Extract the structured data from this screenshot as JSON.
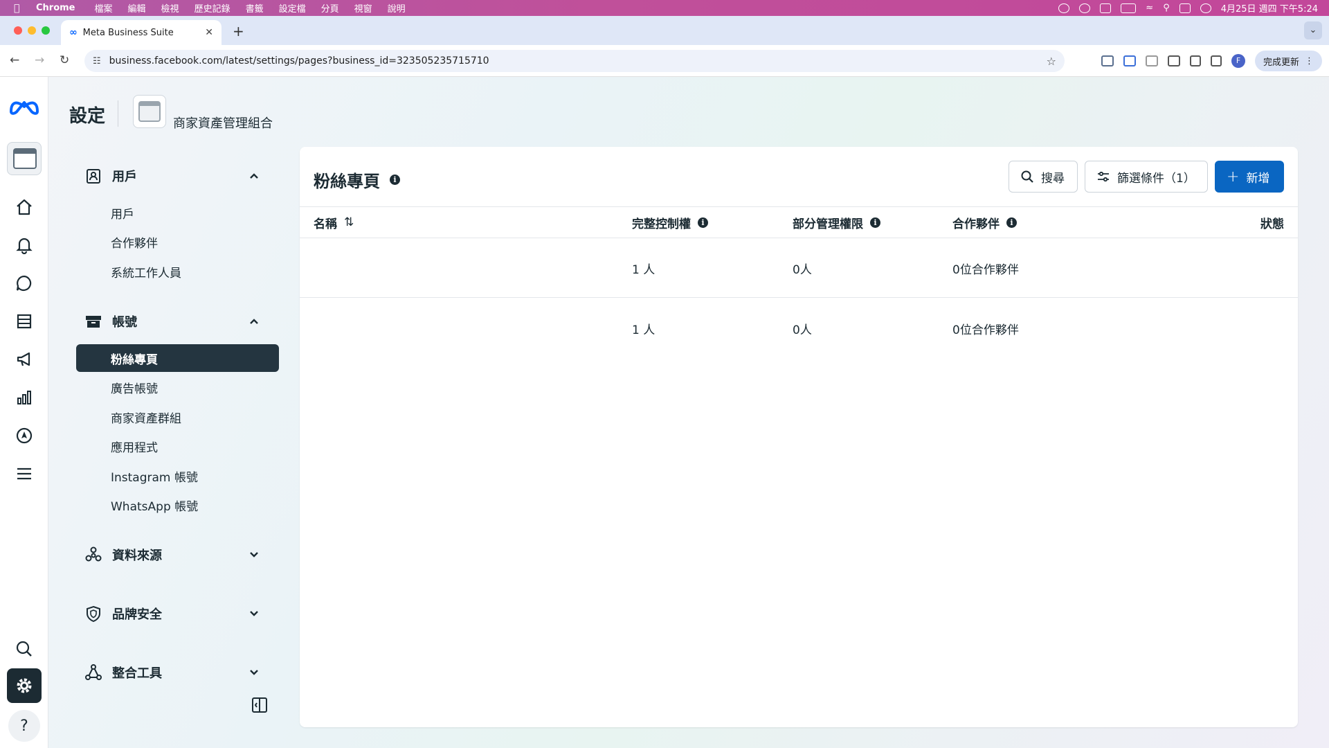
{
  "menubar": {
    "app": "Chrome",
    "menus": [
      "檔案",
      "編輯",
      "檢視",
      "歷史記錄",
      "書籤",
      "設定檔",
      "分頁",
      "視窗",
      "說明"
    ],
    "datetime": "4月25日 週四 下午5:24"
  },
  "browser": {
    "tab_title": "Meta Business Suite",
    "url": "business.facebook.com/latest/settings/pages?business_id=323505235715710",
    "update_label": "完成更新",
    "profile_initial": "F"
  },
  "header": {
    "title": "設定",
    "business_name": "商家資產管理組合"
  },
  "nav": {
    "users_section": "用戶",
    "users_items": [
      "用戶",
      "合作夥伴",
      "系統工作人員"
    ],
    "accounts_section": "帳號",
    "accounts_items": [
      "粉絲專頁",
      "廣告帳號",
      "商家資產群組",
      "應用程式",
      "Instagram 帳號",
      "WhatsApp 帳號"
    ],
    "data_sources_section": "資料來源",
    "brand_safety_section": "品牌安全",
    "integrations_section": "整合工具"
  },
  "main": {
    "title": "粉絲專頁",
    "search_label": "搜尋",
    "filter_label": "篩選條件（1）",
    "add_label": "新增",
    "columns": {
      "name": "名稱",
      "full_control": "完整控制權",
      "partial_access": "部分管理權限",
      "partners": "合作夥伴",
      "status": "狀態"
    },
    "rows": [
      {
        "name": "",
        "full_control": "1 人",
        "partial_access": "0人",
        "partners": "0位合作夥伴",
        "status": ""
      },
      {
        "name": "",
        "full_control": "1 人",
        "partial_access": "0人",
        "partners": "0位合作夥伴",
        "status": ""
      }
    ]
  },
  "colors": {
    "primary": "#0a66c2",
    "active_nav": "#243540",
    "text": "#1c2b33"
  }
}
